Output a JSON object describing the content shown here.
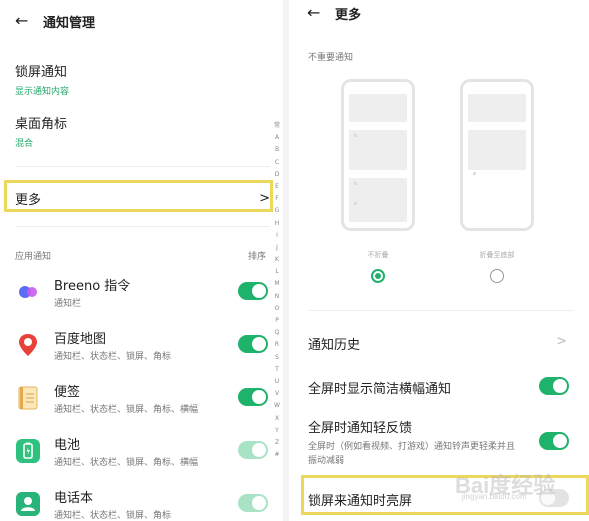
{
  "left": {
    "header": {
      "back_icon": "←",
      "title": "通知管理"
    },
    "lock_screen": {
      "title": "锁屏通知",
      "value": "显示通知内容"
    },
    "badge": {
      "title": "桌面角标",
      "value": "混合"
    },
    "more": {
      "label": "更多",
      "chevron": ">"
    },
    "apps_section": {
      "label": "应用通知",
      "sort": "排序"
    },
    "apps": [
      {
        "name": "Breeno 指令",
        "sub": "通知栏",
        "icon": "breeno-icon",
        "enabled": true
      },
      {
        "name": "百度地图",
        "sub": "通知栏、状态栏、锁屏、角标",
        "icon": "map-pin-icon",
        "enabled": true
      },
      {
        "name": "便签",
        "sub": "通知栏、状态栏、锁屏、角标、横幅",
        "icon": "notes-icon",
        "enabled": true
      },
      {
        "name": "电池",
        "sub": "通知栏、状态栏、锁屏、角标、横幅",
        "icon": "battery-icon",
        "enabled": true
      },
      {
        "name": "电话本",
        "sub": "通知栏、状态栏、锁屏、角标",
        "icon": "contacts-icon",
        "enabled": true
      }
    ],
    "index_letters": [
      "常",
      "A",
      "B",
      "C",
      "D",
      "E",
      "F",
      "G",
      "H",
      "I",
      "J",
      "K",
      "L",
      "M",
      "N",
      "O",
      "P",
      "Q",
      "R",
      "S",
      "T",
      "U",
      "V",
      "W",
      "X",
      "Y",
      "Z",
      "#"
    ]
  },
  "right": {
    "header": {
      "back_icon": "←",
      "title": "更多"
    },
    "unimportant": {
      "label": "不重要通知",
      "options": [
        {
          "caption": "不折叠",
          "selected": true
        },
        {
          "caption": "折叠至底部",
          "selected": false
        }
      ]
    },
    "history": {
      "title": "通知历史",
      "chevron": ">"
    },
    "fullscreen_banner": {
      "title": "全屏时显示简洁横幅通知",
      "enabled": true
    },
    "fullscreen_light": {
      "title": "全屏时通知轻反馈",
      "desc": "全屏时（例如看视频、打游戏）通知铃声更轻柔并且振动减弱",
      "enabled": true
    },
    "lockscreen_wake": {
      "title": "锁屏来通知时亮屏",
      "enabled": false
    }
  },
  "watermark": {
    "text": "Bai度经验",
    "url": "jingyan.baidu.com"
  },
  "colors": {
    "accent": "#1fb26b",
    "highlight": "#ecd95c",
    "subtext_green": "#23a86b"
  }
}
